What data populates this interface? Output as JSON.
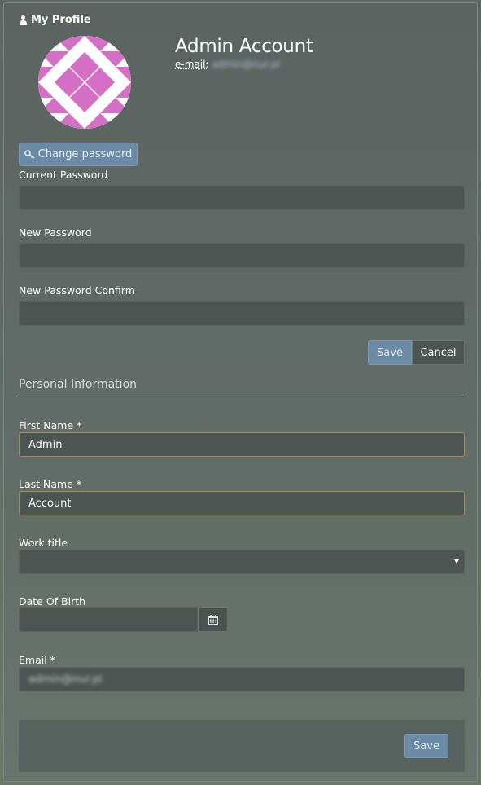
{
  "panel": {
    "title": "My Profile"
  },
  "profile": {
    "name": "Admin Account",
    "email_label": "e-mail:",
    "email_value": "admin@nur.pl"
  },
  "password": {
    "change_button": "Change password",
    "current_label": "Current Password",
    "new_label": "New Password",
    "confirm_label": "New Password Confirm",
    "save": "Save",
    "cancel": "Cancel"
  },
  "personal": {
    "section_title": "Personal Information",
    "first_name_label": "First Name *",
    "first_name_value": "Admin",
    "last_name_label": "Last Name *",
    "last_name_value": "Account",
    "work_title_label": "Work title",
    "dob_label": "Date Of Birth",
    "email_label": "Email *",
    "email_value": "admin@nur.pl",
    "save": "Save"
  },
  "colors": {
    "accent_button": "#6b8aa6",
    "avatar_pink": "#d46fc5",
    "input_bg": "#4c5552",
    "focus_border": "#a68f4e"
  }
}
